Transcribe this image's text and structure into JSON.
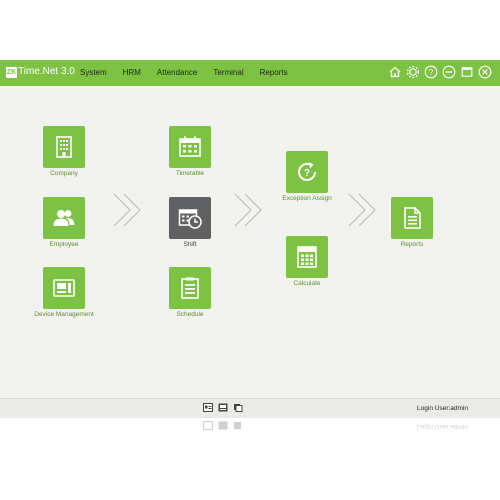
{
  "app": {
    "logo": "ZK",
    "title": "Time.Net 3.0"
  },
  "menu": [
    "System",
    "HRM",
    "Attendance",
    "Terminal",
    "Reports"
  ],
  "window_icons": [
    "home-icon",
    "settings-icon",
    "help-icon",
    "minimize-icon",
    "maximize-icon",
    "close-icon"
  ],
  "tiles": {
    "company": "Company",
    "employee": "Employee",
    "device": "Device Management",
    "timetable": "Timetable",
    "shift": "Shift",
    "schedule": "Schedule",
    "exception": "Exception Assign",
    "calculate": "Calculate",
    "reports": "Reports"
  },
  "footer": {
    "login_user": "Login User:admin"
  },
  "colors": {
    "brand": "#7dc243",
    "dark_tile": "#5f6163"
  }
}
